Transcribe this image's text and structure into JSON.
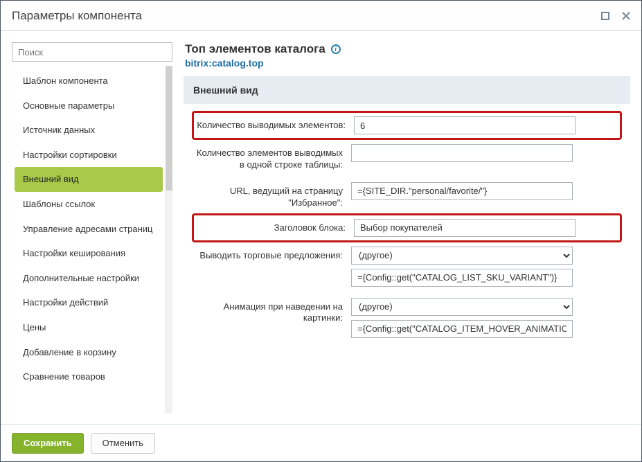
{
  "window": {
    "title": "Параметры компонента"
  },
  "sidebar": {
    "search_placeholder": "Поиск",
    "items": [
      {
        "label": "Шаблон компонента"
      },
      {
        "label": "Основные параметры"
      },
      {
        "label": "Источник данных"
      },
      {
        "label": "Настройки сортировки"
      },
      {
        "label": "Внешний вид"
      },
      {
        "label": "Шаблоны ссылок"
      },
      {
        "label": "Управление адресами страниц"
      },
      {
        "label": "Настройки кеширования"
      },
      {
        "label": "Дополнительные настройки"
      },
      {
        "label": "Настройки действий"
      },
      {
        "label": "Цены"
      },
      {
        "label": "Добавление в корзину"
      },
      {
        "label": "Сравнение товаров"
      }
    ],
    "active_index": 4
  },
  "header": {
    "title": "Топ элементов каталога",
    "code": "bitrix:catalog.top"
  },
  "section": {
    "title": "Внешний вид"
  },
  "fields": {
    "count": {
      "label": "Количество выводимых элементов:",
      "value": "6"
    },
    "per_row": {
      "label": "Количество элементов выводимых в одной строке таблицы:",
      "value": ""
    },
    "fav_url": {
      "label": "URL, ведущий на страницу \"Избранное\":",
      "value": "={SITE_DIR.\"personal/favorite/\"}"
    },
    "block_title": {
      "label": "Заголовок блока:",
      "value": "Выбор покупателей"
    },
    "sku": {
      "label": "Выводить торговые предложения:",
      "select": "(другое)",
      "value": "={Config::get(\"CATALOG_LIST_SKU_VARIANT\")}"
    },
    "hover": {
      "label": "Анимация при наведении на картинки:",
      "select": "(другое)",
      "value": "={Config::get(\"CATALOG_ITEM_HOVER_ANIMATION\")}"
    }
  },
  "footer": {
    "save": "Сохранить",
    "cancel": "Отменить"
  }
}
